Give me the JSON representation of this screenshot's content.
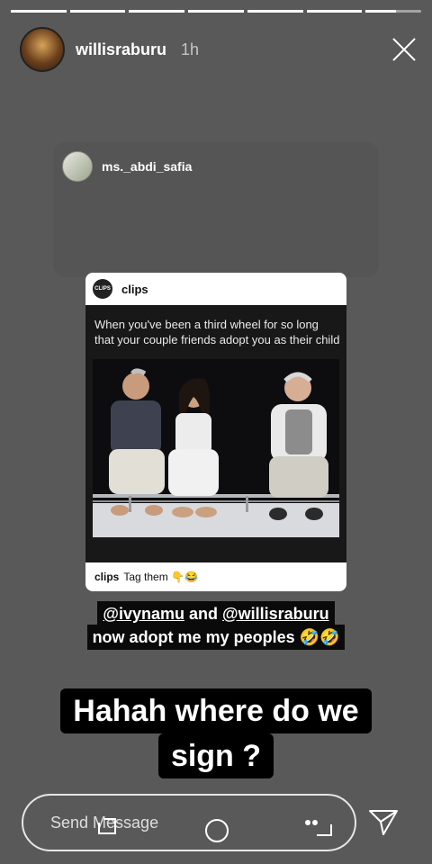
{
  "progress": [
    1,
    1,
    1,
    1,
    1,
    1,
    0.55
  ],
  "header": {
    "username": "willisraburu",
    "time": "1h"
  },
  "shared_post": {
    "username": "ms._abdi_safia"
  },
  "clip": {
    "account": "clips",
    "logo_text": "CLIPS",
    "caption": "When you've been a third wheel for so long that your couple friends adopt you as their child",
    "footer_user": "clips",
    "footer_text": "Tag them 👇😂"
  },
  "tag_text": {
    "mention1": "@ivynamu",
    "joiner": "and",
    "mention2": "@willisraburu",
    "line2": "now adopt me my peoples 🤣🤣"
  },
  "reply_text": {
    "line1": "Hahah where do we",
    "line2": "sign ?"
  },
  "composer": {
    "placeholder": "Send Message"
  },
  "colors": {
    "background": "#595959",
    "text_box": "#000000"
  }
}
